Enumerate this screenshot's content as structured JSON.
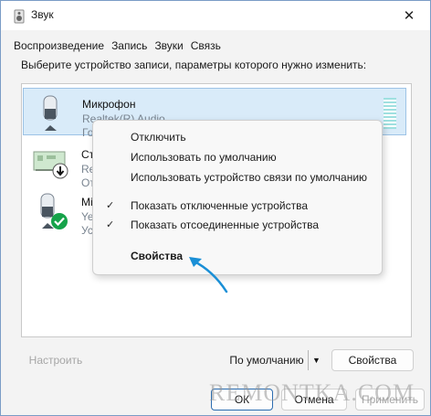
{
  "window": {
    "title": "Звук",
    "close_glyph": "✕"
  },
  "tabs": [
    {
      "label": "Воспроизведение",
      "active": false
    },
    {
      "label": "Запись",
      "active": true
    },
    {
      "label": "Звуки",
      "active": false
    },
    {
      "label": "Связь",
      "active": false
    }
  ],
  "instruction": "Выберите устройство записи, параметры которого нужно изменить:",
  "devices": [
    {
      "name": "Микрофон",
      "description": "Realtek(R) Audio",
      "status": "Гото",
      "icon": "microphone-icon",
      "selected": true
    },
    {
      "name": "Сте",
      "description": "Real",
      "status": "От",
      "icon": "sound-card-icon",
      "badge": "arrow-down-badge-icon"
    },
    {
      "name": "Mic",
      "description": "Yet",
      "status": "Уст",
      "icon": "microphone-icon",
      "badge": "green-check-badge-icon"
    }
  ],
  "context_menu": {
    "items": [
      {
        "label": "Отключить",
        "checked": false,
        "bold": false
      },
      {
        "label": "Использовать по умолчанию",
        "checked": false,
        "bold": false
      },
      {
        "label": "Использовать устройство связи по умолчанию",
        "checked": false,
        "bold": false
      },
      {
        "label": "Показать отключенные устройства",
        "checked": true,
        "bold": false
      },
      {
        "label": "Показать отсоединенные устройства",
        "checked": true,
        "bold": false
      },
      {
        "label": "Свойства",
        "checked": false,
        "bold": true
      }
    ],
    "check_glyph": "✓"
  },
  "buttons": {
    "configure": "Настроить",
    "default": "По умолчанию",
    "default_arrow": "▼",
    "properties": "Свойства",
    "ok": "ОК",
    "cancel": "Отмена",
    "apply": "Применить"
  },
  "watermark": "REMONTKA.COM",
  "colors": {
    "accent": "#1a8fd6",
    "selection": "#d9ebf9",
    "level_meter": "#9fe0e0",
    "check_badge": "#16a34a"
  }
}
